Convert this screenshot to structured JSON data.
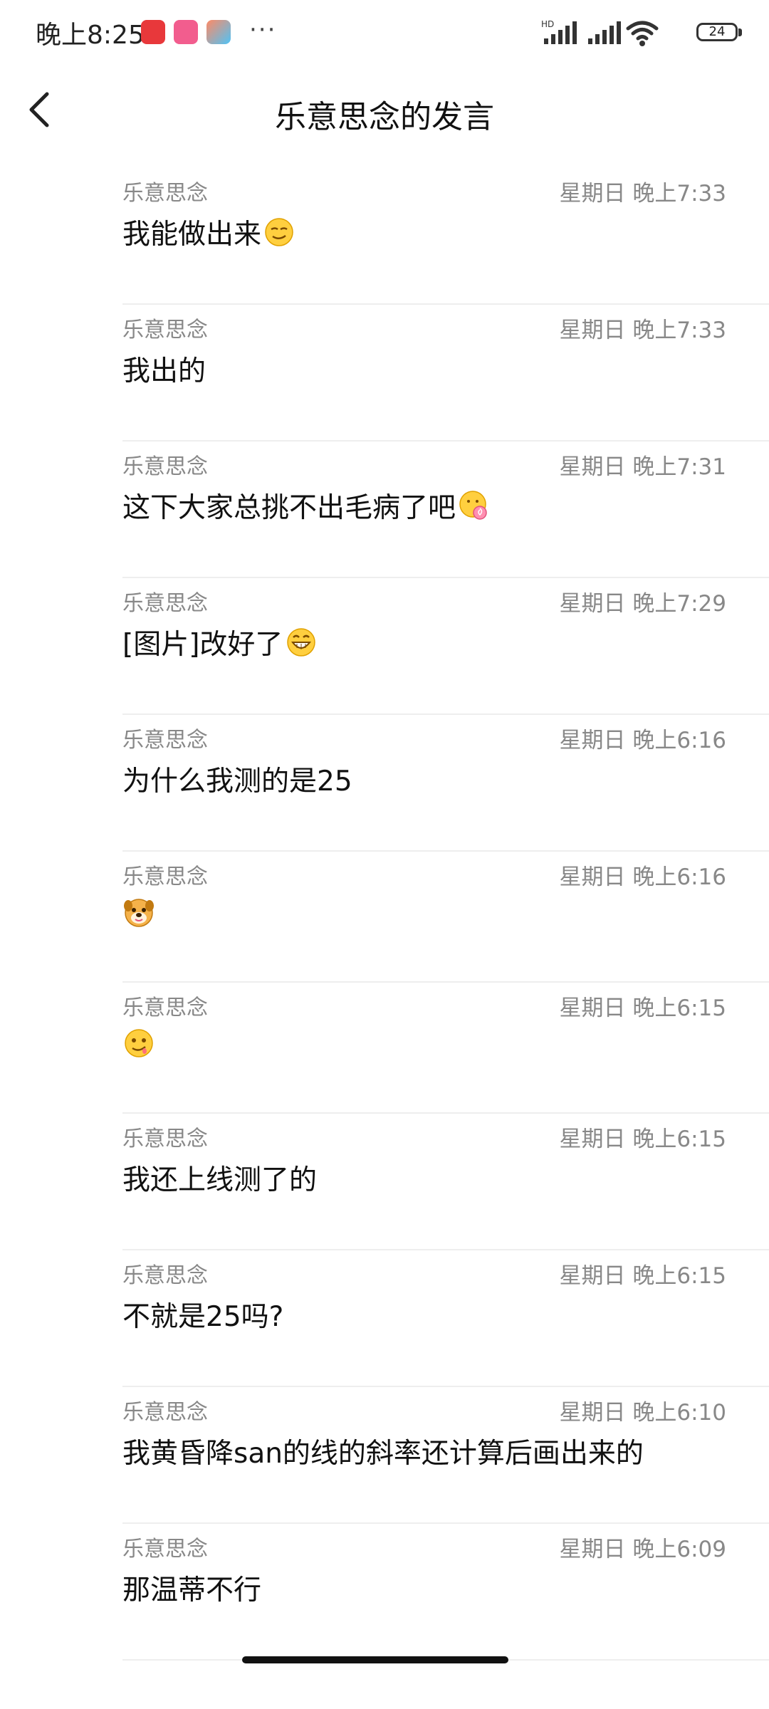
{
  "status_bar": {
    "time": "晚上8:25",
    "signal_badge": "HD",
    "battery": "24",
    "overflow": "···"
  },
  "header": {
    "title": "乐意思念的发言"
  },
  "messages": [
    {
      "author": "乐意思念",
      "time": "星期日 晚上7:33",
      "text": "我能做出来",
      "emoji": "smirk-face"
    },
    {
      "author": "乐意思念",
      "time": "星期日 晚上7:33",
      "text": "我出的"
    },
    {
      "author": "乐意思念",
      "time": "星期日 晚上7:31",
      "text": "这下大家总挑不出毛病了吧",
      "emoji": "lollipop-face"
    },
    {
      "author": "乐意思念",
      "time": "星期日 晚上7:29",
      "text": "[图片]改好了",
      "emoji": "grin-face"
    },
    {
      "author": "乐意思念",
      "time": "星期日 晚上6:16",
      "text": "为什么我测的是25"
    },
    {
      "author": "乐意思念",
      "time": "星期日 晚上6:16",
      "text": "",
      "emoji": "dog-face"
    },
    {
      "author": "乐意思念",
      "time": "星期日 晚上6:15",
      "text": "",
      "emoji": "drool-face"
    },
    {
      "author": "乐意思念",
      "time": "星期日 晚上6:15",
      "text": "我还上线测了的"
    },
    {
      "author": "乐意思念",
      "time": "星期日 晚上6:15",
      "text": "不就是25吗?"
    },
    {
      "author": "乐意思念",
      "time": "星期日 晚上6:10",
      "text": "我黄昏降san的线的斜率还计算后画出来的"
    },
    {
      "author": "乐意思念",
      "time": "星期日 晚上6:09",
      "text": "那温蒂不行"
    }
  ]
}
